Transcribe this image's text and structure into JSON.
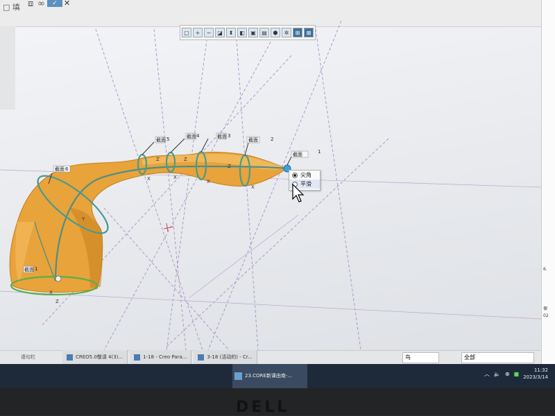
{
  "topbar": {
    "left_text": "□ 填 ",
    "icons": [
      "box-icon",
      "glasses-icon",
      "check-icon",
      "close-icon"
    ]
  },
  "view_toolbar": {
    "buttons": [
      "refit",
      "zoom-in",
      "zoom-out",
      "repaint",
      "perspective",
      "display-style",
      "saved-orientation",
      "view-manager",
      "datum-display",
      "spin-center",
      "annotation-display",
      "active-toggle"
    ]
  },
  "model": {
    "section_labels": [
      {
        "tag": "截面",
        "num": "1"
      },
      {
        "tag": "截面",
        "num": "2"
      },
      {
        "tag": "截面",
        "num": "3"
      },
      {
        "tag": "截面",
        "num": "4"
      },
      {
        "tag": "截面",
        "num": "5"
      },
      {
        "tag": "截面",
        "num": "6"
      },
      {
        "tag": "截面",
        "num": "1"
      }
    ],
    "axis_letters": {
      "x": "X",
      "z": "Z",
      "y": "Y"
    },
    "colors": {
      "surface": "#e8a33a",
      "surface_dark": "#c47e1c",
      "trajectory": "#4d8e88",
      "section": "#4a9a8e",
      "datum": "#a98fc5",
      "endpoint": "#3aa3e0"
    }
  },
  "popup": {
    "options": [
      {
        "label": "尖角",
        "selected": true
      },
      {
        "label": "平滑",
        "selected": false
      }
    ]
  },
  "statusbar": {
    "left_word": "语句栏",
    "font_select": "鸟",
    "filter_value": "全部"
  },
  "document_tabs": [
    {
      "label": "CREO5.0敬请 4(3)..."
    },
    {
      "label": "1-18 - Creo Para..."
    },
    {
      "label": "3-18 (活动的) - Cr..."
    }
  ],
  "taskbar": {
    "apps": [
      {
        "label": "23.CORE新课由南-..."
      }
    ],
    "clock_time": "11:32",
    "clock_date": "2023/3/14",
    "tray_icons": [
      "chevron-up-icon",
      "volume-icon",
      "network-icon",
      "wechat-icon"
    ]
  },
  "right_edge": {
    "chars": [
      "6.",
      "保",
      "02"
    ]
  },
  "bezel": {
    "brand": "DELL"
  }
}
